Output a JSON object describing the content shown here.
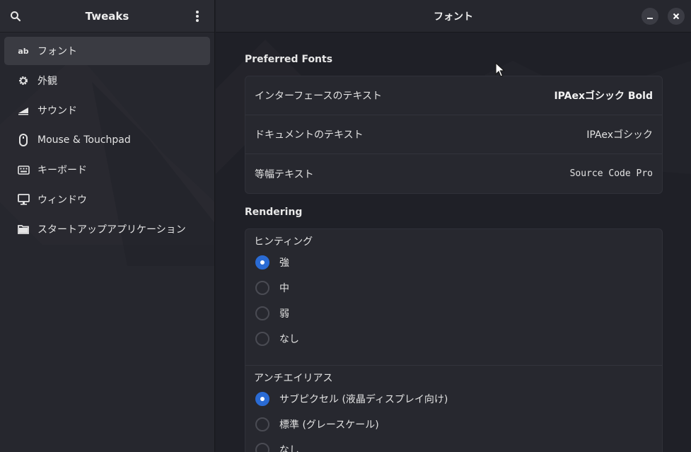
{
  "sidebar": {
    "title": "Tweaks",
    "items": [
      {
        "label": "フォント",
        "icon": "ab",
        "active": true
      },
      {
        "label": "外観",
        "icon": "gear-icon"
      },
      {
        "label": "サウンド",
        "icon": "volume-icon"
      },
      {
        "label": "Mouse & Touchpad",
        "icon": "mouse-icon"
      },
      {
        "label": "キーボード",
        "icon": "keyboard-icon"
      },
      {
        "label": "ウィンドウ",
        "icon": "monitor-icon"
      },
      {
        "label": "スタートアップアプリケーション",
        "icon": "folder-icon"
      }
    ]
  },
  "main": {
    "title": "フォント",
    "preferred_fonts": {
      "title": "Preferred Fonts",
      "rows": [
        {
          "label": "インターフェースのテキスト",
          "value": "IPAexゴシック Bold"
        },
        {
          "label": "ドキュメントのテキスト",
          "value": "IPAexゴシック"
        },
        {
          "label": "等幅テキスト",
          "value": "Source Code Pro"
        }
      ]
    },
    "rendering": {
      "title": "Rendering",
      "hinting": {
        "label": "ヒンティング",
        "options": [
          "強",
          "中",
          "弱",
          "なし"
        ],
        "selected": "強"
      },
      "antialiasing": {
        "label": "アンチエイリアス",
        "options": [
          "サブピクセル (液晶ディスプレイ向け)",
          "標準 (グレースケール)",
          "なし"
        ],
        "selected": "サブピクセル (液晶ディスプレイ向け)"
      }
    }
  },
  "colors": {
    "accent": "#2a6bd4",
    "sidebar_bg": "#26272e",
    "content_bg": "#1f2027",
    "card_bg": "#27282f"
  }
}
